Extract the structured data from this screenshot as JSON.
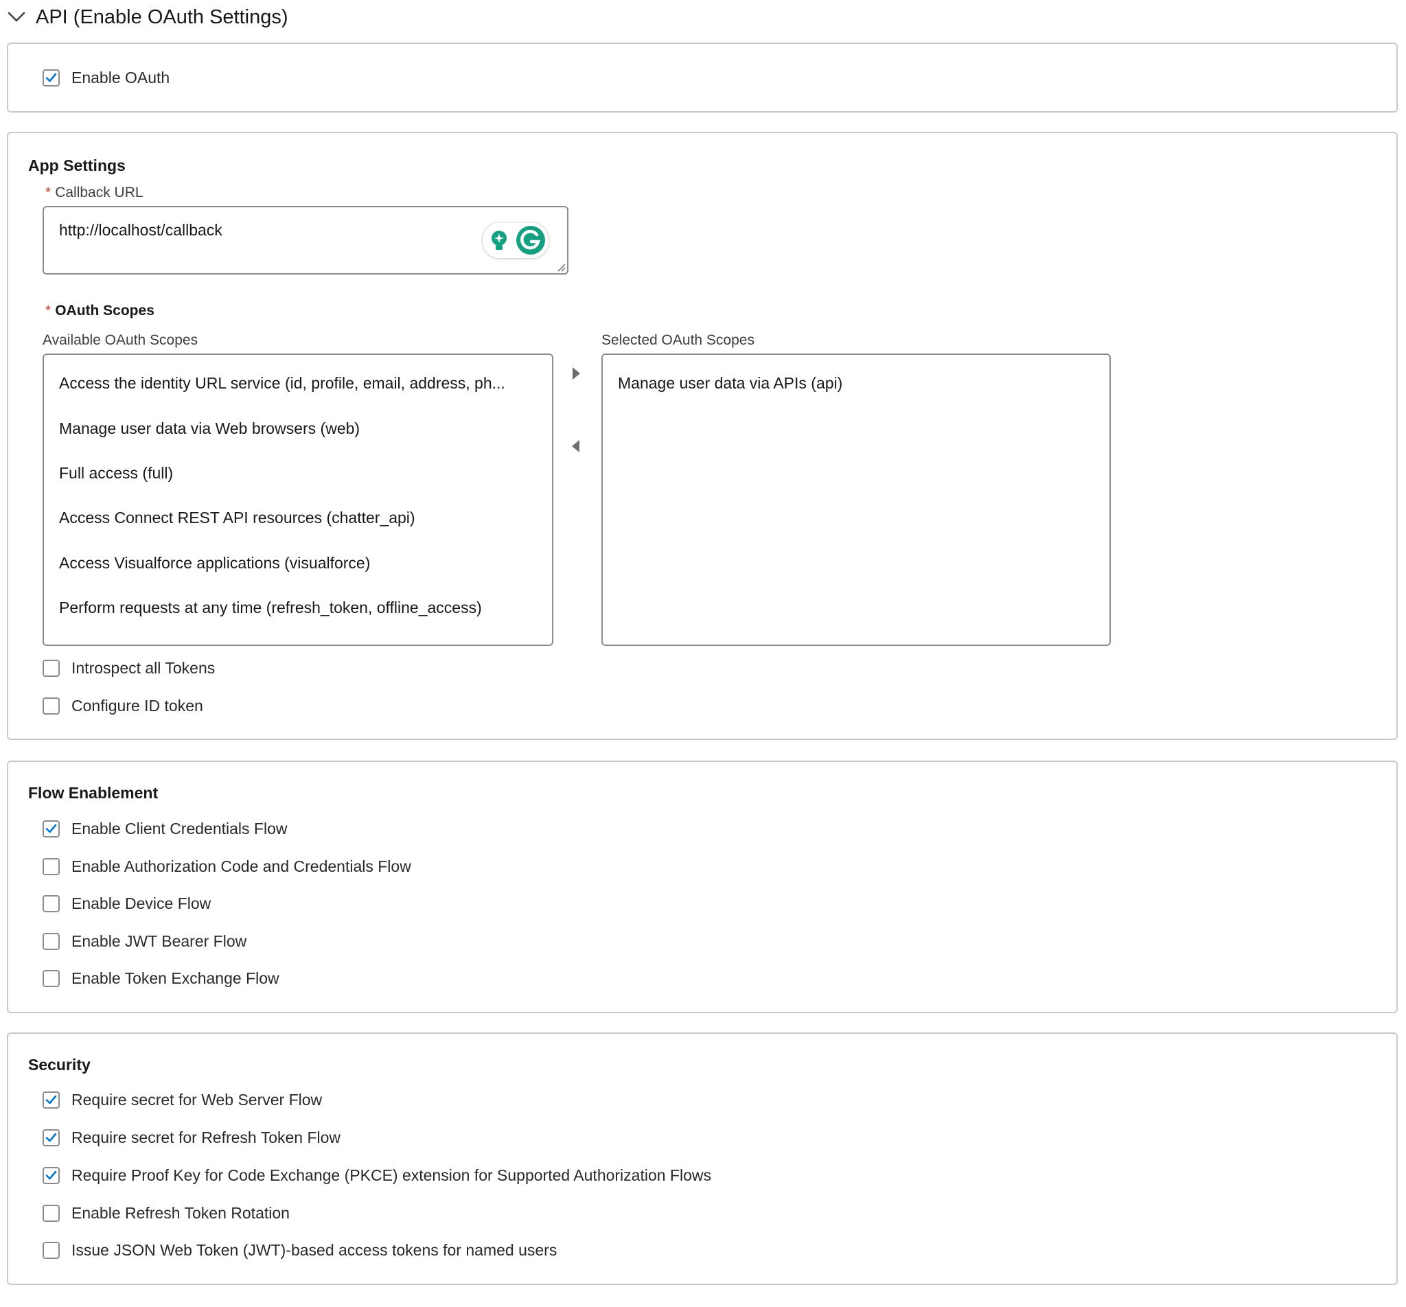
{
  "header": {
    "title": "API (Enable OAuth Settings)",
    "icon": "chevron-down-icon"
  },
  "enable_oauth": {
    "label": "Enable OAuth",
    "checked": true
  },
  "app_settings": {
    "title": "App Settings",
    "callback_url": {
      "required_mark": "*",
      "label": "Callback URL",
      "value": "http://localhost/callback"
    },
    "oauth_scopes": {
      "required_mark": "*",
      "label": "OAuth Scopes",
      "available_label": "Available OAuth Scopes",
      "selected_label": "Selected OAuth Scopes",
      "available": [
        "Access the identity URL service (id, profile, email, address, ph...",
        "Manage user data via Web browsers (web)",
        "Full access (full)",
        "Access Connect REST API resources (chatter_api)",
        "Access Visualforce applications (visualforce)",
        "Perform requests at any time (refresh_token, offline_access)"
      ],
      "selected": [
        "Manage user data via APIs (api)"
      ]
    },
    "checkboxes": [
      {
        "label": "Introspect all Tokens",
        "checked": false
      },
      {
        "label": "Configure ID token",
        "checked": false
      }
    ]
  },
  "flow_enablement": {
    "title": "Flow Enablement",
    "checkboxes": [
      {
        "label": "Enable Client Credentials Flow",
        "checked": true
      },
      {
        "label": "Enable Authorization Code and Credentials Flow",
        "checked": false
      },
      {
        "label": "Enable Device Flow",
        "checked": false
      },
      {
        "label": "Enable JWT Bearer Flow",
        "checked": false
      },
      {
        "label": "Enable Token Exchange Flow",
        "checked": false
      }
    ]
  },
  "security": {
    "title": "Security",
    "checkboxes": [
      {
        "label": "Require secret for Web Server Flow",
        "checked": true
      },
      {
        "label": "Require secret for Refresh Token Flow",
        "checked": true
      },
      {
        "label": "Require Proof Key for Code Exchange (PKCE) extension for Supported Authorization Flows",
        "checked": true
      },
      {
        "label": "Enable Refresh Token Rotation",
        "checked": false
      },
      {
        "label": "Issue JSON Web Token (JWT)-based access tokens for named users",
        "checked": false
      }
    ]
  },
  "colors": {
    "check": "#0176d3",
    "checkbox_border": "#8c8c8c",
    "required": "#c23934",
    "card_border": "#c9c9c9",
    "grammarly": "#15a081"
  }
}
